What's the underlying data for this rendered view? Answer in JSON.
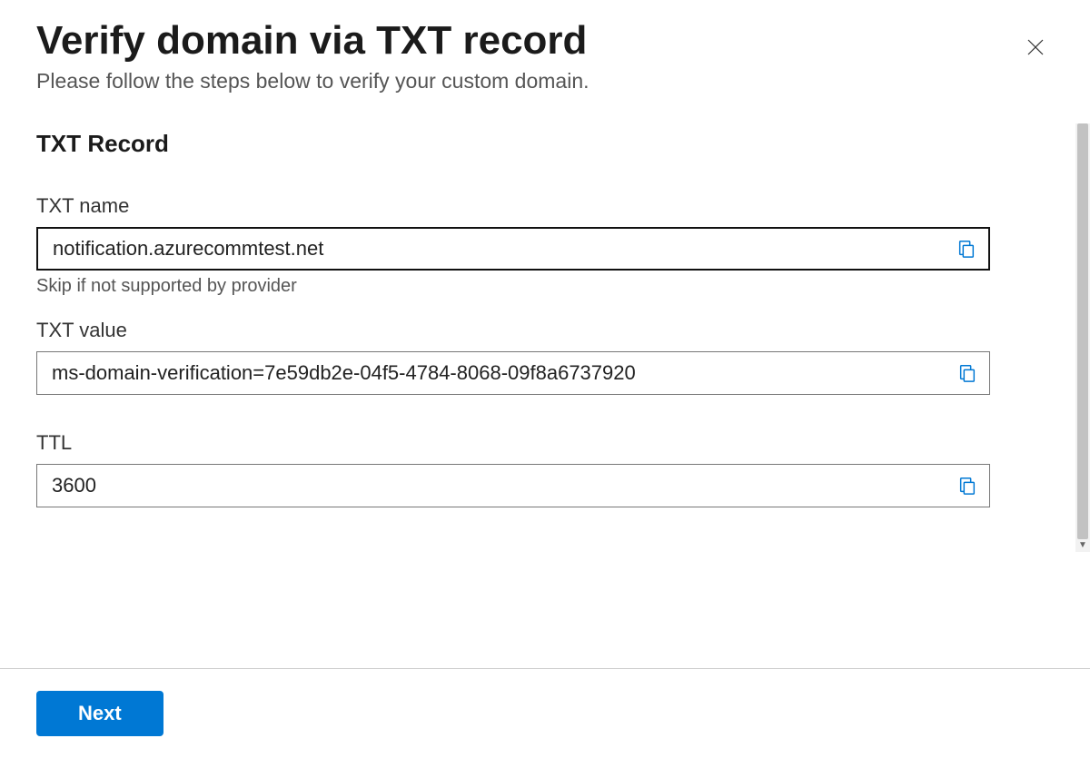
{
  "header": {
    "title": "Verify domain via TXT record",
    "subtitle": "Please follow the steps below to verify your custom domain."
  },
  "section": {
    "title": "TXT Record"
  },
  "fields": {
    "txt_name": {
      "label": "TXT name",
      "value": "notification.azurecommtest.net",
      "hint": "Skip if not supported by provider"
    },
    "txt_value": {
      "label": "TXT value",
      "value": "ms-domain-verification=7e59db2e-04f5-4784-8068-09f8a6737920"
    },
    "ttl": {
      "label": "TTL",
      "value": "3600"
    }
  },
  "footer": {
    "next_label": "Next"
  },
  "colors": {
    "accent": "#0078d4"
  }
}
